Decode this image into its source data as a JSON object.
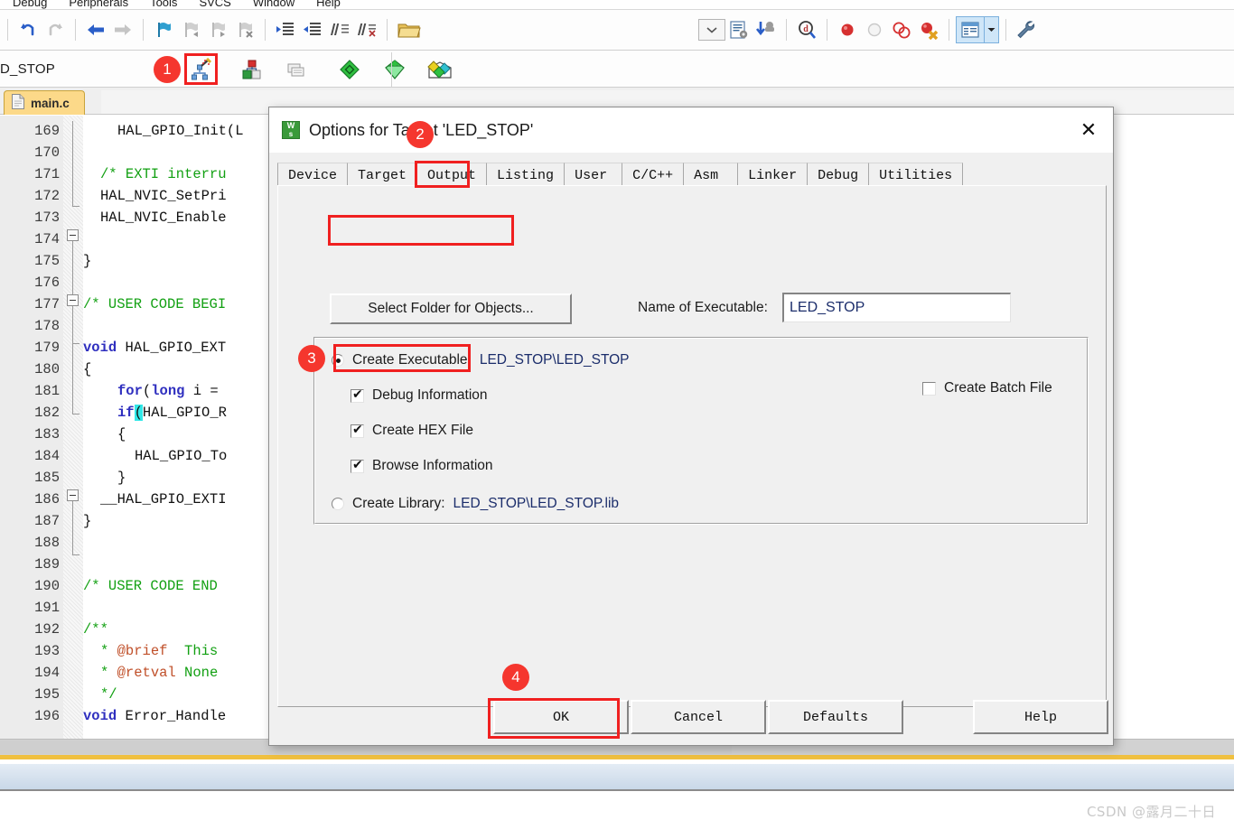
{
  "menubar": {
    "items": [
      "Debug",
      "Peripherals",
      "Tools",
      "SVCS",
      "Window",
      "Help"
    ]
  },
  "toolbar": {
    "undo": "Undo",
    "redo": "Redo",
    "back": "Navigate Backwards",
    "forward": "Navigate Forwards",
    "bookmark": "Insert/Remove Bookmark",
    "bookmark_prev": "Go to Previous Bookmark",
    "bookmark_next": "Go to Next Bookmark",
    "bookmark_clear": "Clear All Bookmarks",
    "indent": "Indent Selected Text",
    "outdent": "Outdent Selected Text",
    "comment": "Comment Selection",
    "uncomment": "Uncomment Selection",
    "open_file": "Open File",
    "dropdown": "Target Options Dropdown",
    "config_wizard": "Configuration Wizard",
    "download": "Download",
    "find": "Find in Files",
    "breakpoint": "Insert/Remove Breakpoint",
    "breakpoint_disable": "Enable/Disable Breakpoint",
    "breakpoint_disable_all": "Disable All Breakpoints",
    "breakpoint_kill": "Kill All Breakpoints",
    "window_mgr": "Manage Project Items",
    "settings": "Configure"
  },
  "toolbar2": {
    "target_name": "D_STOP",
    "options_target": "Options for Target",
    "manage_project": "Manage Project Items",
    "batch_build": "Batch Build",
    "build": "Build",
    "rebuild": "Rebuild",
    "translate": "Translate Current File"
  },
  "tabs": {
    "active_file": "main.c"
  },
  "editor": {
    "lines": [
      {
        "no": "169",
        "indent": 2,
        "segs": [
          [
            "pl",
            "HAL_GPIO_Init(L"
          ]
        ]
      },
      {
        "no": "170",
        "indent": 0,
        "segs": []
      },
      {
        "no": "171",
        "indent": 1,
        "segs": [
          [
            "cm",
            "/* EXTI interru"
          ]
        ]
      },
      {
        "no": "172",
        "indent": 1,
        "segs": [
          [
            "pl",
            "HAL_NVIC_SetPri"
          ]
        ]
      },
      {
        "no": "173",
        "indent": 1,
        "segs": [
          [
            "pl",
            "HAL_NVIC_Enable"
          ]
        ]
      },
      {
        "no": "174",
        "indent": 0,
        "segs": []
      },
      {
        "no": "175",
        "indent": 0,
        "segs": [
          [
            "pl",
            "}"
          ]
        ]
      },
      {
        "no": "176",
        "indent": 0,
        "segs": []
      },
      {
        "no": "177",
        "indent": 0,
        "segs": [
          [
            "cm",
            "/* USER CODE BEGI"
          ]
        ]
      },
      {
        "no": "178",
        "indent": 0,
        "segs": []
      },
      {
        "no": "179",
        "indent": 0,
        "segs": [
          [
            "kw",
            "void"
          ],
          [
            "pl",
            " HAL_GPIO_EXT"
          ]
        ]
      },
      {
        "no": "180",
        "indent": 0,
        "segs": [
          [
            "pl",
            "{"
          ]
        ],
        "fold": true
      },
      {
        "no": "181",
        "indent": 2,
        "segs": [
          [
            "kw",
            "for"
          ],
          [
            "pl",
            "("
          ],
          [
            "kw",
            "long"
          ],
          [
            "pl",
            " i = "
          ]
        ]
      },
      {
        "no": "182",
        "indent": 2,
        "segs": [
          [
            "kw",
            "if"
          ],
          [
            "hl",
            "("
          ],
          [
            "pl",
            "HAL_GPIO_R"
          ]
        ]
      },
      {
        "no": "183",
        "indent": 2,
        "segs": [
          [
            "pl",
            "{"
          ]
        ],
        "fold": true
      },
      {
        "no": "184",
        "indent": 3,
        "segs": [
          [
            "pl",
            "HAL_GPIO_To"
          ]
        ]
      },
      {
        "no": "185",
        "indent": 2,
        "segs": [
          [
            "pl",
            "}"
          ]
        ]
      },
      {
        "no": "186",
        "indent": 1,
        "segs": [
          [
            "pl",
            "__HAL_GPIO_EXTI"
          ]
        ]
      },
      {
        "no": "187",
        "indent": 0,
        "segs": [
          [
            "pl",
            "}"
          ]
        ]
      },
      {
        "no": "188",
        "indent": 0,
        "segs": []
      },
      {
        "no": "189",
        "indent": 0,
        "segs": []
      },
      {
        "no": "190",
        "indent": 0,
        "segs": [
          [
            "cm",
            "/* USER CODE END"
          ]
        ]
      },
      {
        "no": "191",
        "indent": 0,
        "segs": []
      },
      {
        "no": "192",
        "indent": 0,
        "segs": [
          [
            "cm",
            "/**"
          ]
        ],
        "fold": true
      },
      {
        "no": "193",
        "indent": 1,
        "segs": [
          [
            "cm",
            "* "
          ],
          [
            "tag",
            "@brief"
          ],
          [
            "cm",
            "  This"
          ]
        ]
      },
      {
        "no": "194",
        "indent": 1,
        "segs": [
          [
            "cm",
            "* "
          ],
          [
            "tag",
            "@retval"
          ],
          [
            "cm",
            " None"
          ]
        ]
      },
      {
        "no": "195",
        "indent": 1,
        "segs": [
          [
            "cm",
            "*/"
          ]
        ]
      },
      {
        "no": "196",
        "indent": 0,
        "segs": [
          [
            "kw",
            "void"
          ],
          [
            "pl",
            " Error_Handle"
          ]
        ]
      }
    ]
  },
  "dialog": {
    "title": "Options for Target 'LED_STOP'",
    "close_label": "✕",
    "tabs": [
      {
        "label": "Device",
        "selected": false
      },
      {
        "label": "Target",
        "selected": false
      },
      {
        "label": "Output",
        "selected": true
      },
      {
        "label": "Listing",
        "selected": false
      },
      {
        "label": "User",
        "selected": false
      },
      {
        "label": "C/C++",
        "selected": false
      },
      {
        "label": "Asm",
        "selected": false
      },
      {
        "label": "Linker",
        "selected": false
      },
      {
        "label": "Debug",
        "selected": false
      },
      {
        "label": "Utilities",
        "selected": false
      }
    ],
    "select_folder_button": "Select Folder for Objects...",
    "name_of_executable_label": "Name of Executable:",
    "name_of_executable_value": "LED_STOP",
    "create_executable_label": "Create Executable:",
    "create_executable_path": "LED_STOP\\LED_STOP",
    "create_executable_checked": true,
    "debug_information_label": "Debug Information",
    "debug_information_checked": true,
    "create_hex_file_label": "Create HEX File",
    "create_hex_file_checked": true,
    "browse_information_label": "Browse Information",
    "browse_information_checked": true,
    "create_batch_file_label": "Create Batch File",
    "create_batch_file_checked": false,
    "create_library_label": "Create Library:",
    "create_library_path": "LED_STOP\\LED_STOP.lib",
    "create_library_checked": false,
    "ok_button": "OK",
    "cancel_button": "Cancel",
    "defaults_button": "Defaults",
    "help_button": "Help"
  },
  "annotations": {
    "badge1": "1",
    "badge2": "2",
    "badge3": "3",
    "badge4": "4"
  },
  "watermark": "CSDN @露月二十日",
  "colors": {
    "accent_red": "#f5362e",
    "tab_yellow": "#fcd989",
    "comment_green": "#12a012",
    "keyword_blue": "#2f2fbf",
    "path_blue": "#1b2d6b",
    "highlight_cyan": "#30e7e7"
  }
}
